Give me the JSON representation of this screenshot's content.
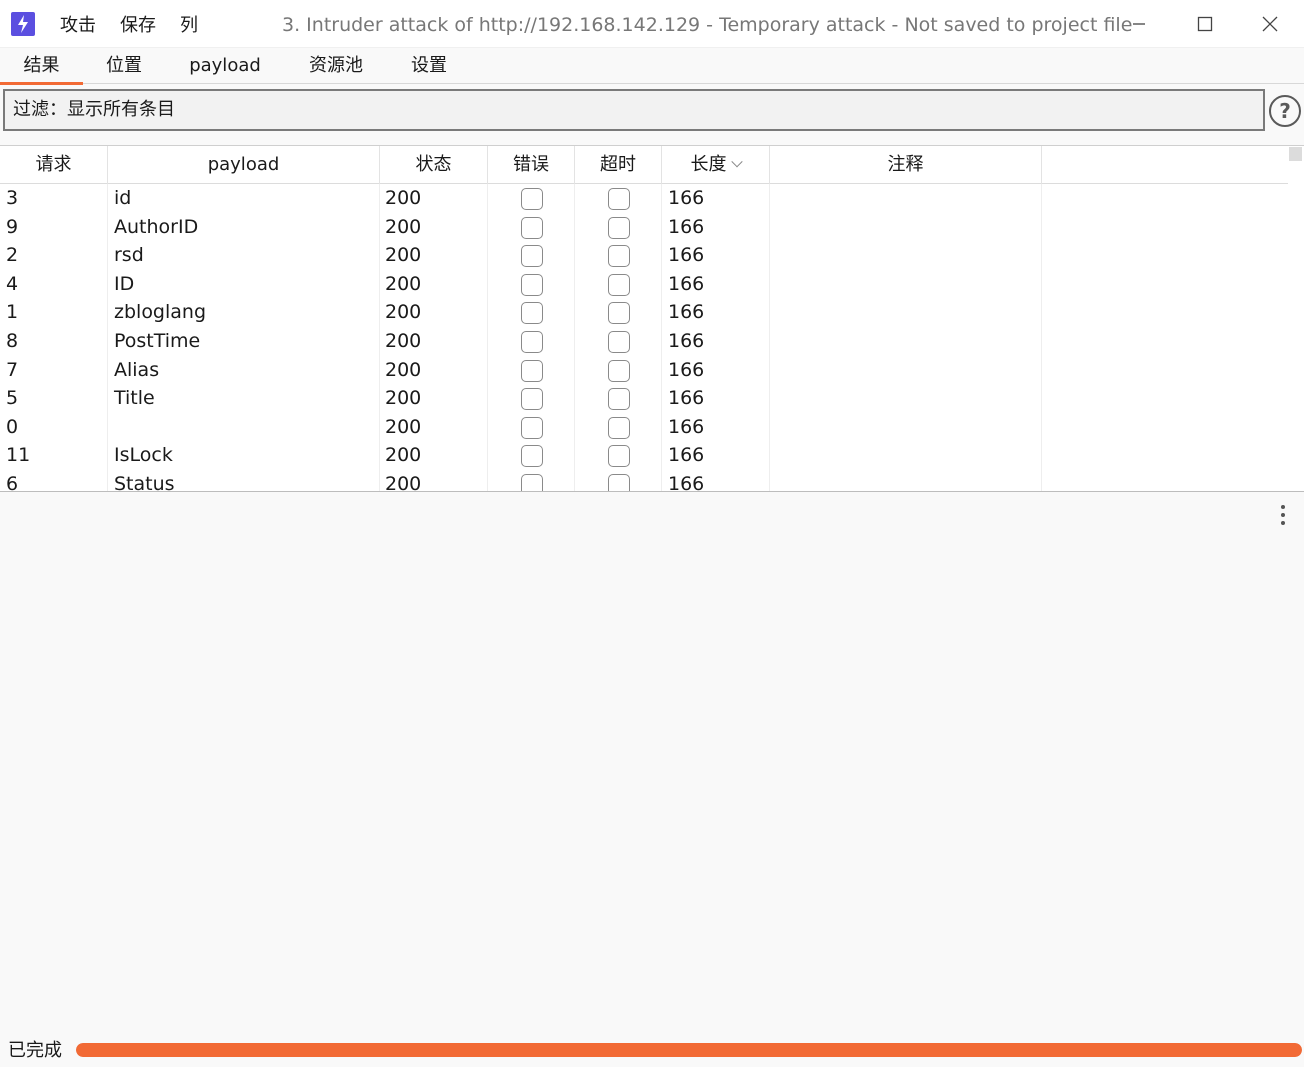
{
  "window": {
    "title": "3. Intruder attack of http://192.168.142.129 - Temporary attack - Not saved to project file",
    "app_icon": "lightning-icon",
    "menu": [
      "攻击",
      "保存",
      "列"
    ],
    "controls": [
      "minimize-icon",
      "maximize-icon",
      "close-icon"
    ]
  },
  "tabs": [
    {
      "label": "结果",
      "active": true
    },
    {
      "label": "位置",
      "active": false
    },
    {
      "label": "payload",
      "active": false
    },
    {
      "label": "资源池",
      "active": false
    },
    {
      "label": "设置",
      "active": false
    }
  ],
  "filter": {
    "text": "过滤：显示所有条目",
    "help_icon": "help-circle-icon",
    "help_glyph": "?"
  },
  "table": {
    "columns": [
      "请求",
      "payload",
      "状态",
      "错误",
      "超时",
      "长度",
      "注释"
    ],
    "sort_column": "长度",
    "rows": [
      {
        "request": "3",
        "payload": "id",
        "status": "200",
        "error": false,
        "timeout": false,
        "length": "166",
        "comment": ""
      },
      {
        "request": "9",
        "payload": "AuthorID",
        "status": "200",
        "error": false,
        "timeout": false,
        "length": "166",
        "comment": ""
      },
      {
        "request": "2",
        "payload": "rsd",
        "status": "200",
        "error": false,
        "timeout": false,
        "length": "166",
        "comment": ""
      },
      {
        "request": "4",
        "payload": "ID",
        "status": "200",
        "error": false,
        "timeout": false,
        "length": "166",
        "comment": ""
      },
      {
        "request": "1",
        "payload": "zbloglang",
        "status": "200",
        "error": false,
        "timeout": false,
        "length": "166",
        "comment": ""
      },
      {
        "request": "8",
        "payload": "PostTime",
        "status": "200",
        "error": false,
        "timeout": false,
        "length": "166",
        "comment": ""
      },
      {
        "request": "7",
        "payload": "Alias",
        "status": "200",
        "error": false,
        "timeout": false,
        "length": "166",
        "comment": ""
      },
      {
        "request": "5",
        "payload": "Title",
        "status": "200",
        "error": false,
        "timeout": false,
        "length": "166",
        "comment": ""
      },
      {
        "request": "0",
        "payload": "",
        "status": "200",
        "error": false,
        "timeout": false,
        "length": "166",
        "comment": ""
      },
      {
        "request": "11",
        "payload": "IsLock",
        "status": "200",
        "error": false,
        "timeout": false,
        "length": "166",
        "comment": ""
      },
      {
        "request": "6",
        "payload": "Status",
        "status": "200",
        "error": false,
        "timeout": false,
        "length": "166",
        "comment": ""
      }
    ]
  },
  "status": {
    "label": "已完成",
    "progress_percent": 100
  },
  "colors": {
    "accent": "#f26a35",
    "app_icon_bg": "#5b4fe0"
  }
}
